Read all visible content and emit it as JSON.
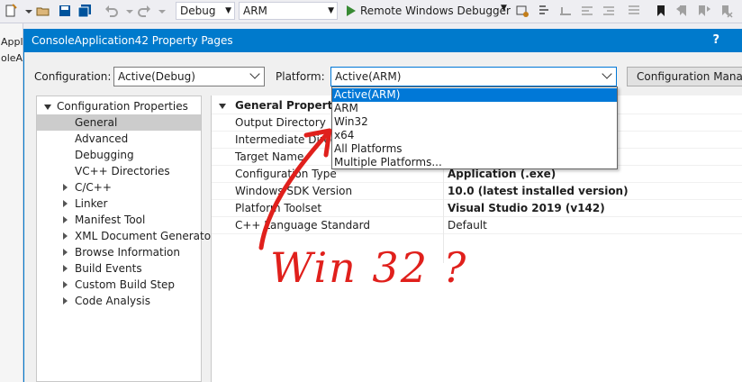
{
  "toolbar": {
    "config": "Debug",
    "platform": "ARM",
    "run_label": "Remote Windows Debugger"
  },
  "solution_strip": {
    "lines": [
      "Appli",
      "oleAp"
    ]
  },
  "dialog": {
    "title": "ConsoleApplication42 Property Pages",
    "help": "?",
    "configuration_label": "Configuration:",
    "configuration_value": "Active(Debug)",
    "platform_label": "Platform:",
    "platform_value": "Active(ARM)",
    "config_manager_label": "Configuration Manager..."
  },
  "platform_dropdown": {
    "options": [
      "Active(ARM)",
      "ARM",
      "Win32",
      "x64",
      "All Platforms",
      "Multiple Platforms..."
    ],
    "highlighted": "Active(ARM)"
  },
  "tree": {
    "root": "Configuration Properties",
    "items": [
      {
        "label": "General",
        "expandable": false,
        "selected": true
      },
      {
        "label": "Advanced",
        "expandable": false
      },
      {
        "label": "Debugging",
        "expandable": false
      },
      {
        "label": "VC++ Directories",
        "expandable": false
      },
      {
        "label": "C/C++",
        "expandable": true
      },
      {
        "label": "Linker",
        "expandable": true
      },
      {
        "label": "Manifest Tool",
        "expandable": true
      },
      {
        "label": "XML Document Generator",
        "expandable": true
      },
      {
        "label": "Browse Information",
        "expandable": true
      },
      {
        "label": "Build Events",
        "expandable": true
      },
      {
        "label": "Custom Build Step",
        "expandable": true
      },
      {
        "label": "Code Analysis",
        "expandable": true
      }
    ]
  },
  "grid": {
    "section": "General Properties",
    "rows": [
      {
        "name": "Output Directory",
        "value": "guration)\\",
        "bold": false
      },
      {
        "name": "Intermediate Directo",
        "value": "",
        "bold": false
      },
      {
        "name": "Target Name",
        "value": "",
        "bold": false
      },
      {
        "name": "Configuration Type",
        "value": "Application (.exe)",
        "bold": true
      },
      {
        "name": "Windows SDK Version",
        "value": "10.0 (latest installed version)",
        "bold": true
      },
      {
        "name": "Platform Toolset",
        "value": "Visual Studio 2019 (v142)",
        "bold": true
      },
      {
        "name": "C++ Language Standard",
        "value": "Default",
        "bold": false
      }
    ]
  },
  "annotation": {
    "text": "Win 32 ?",
    "color": "#e0201c"
  }
}
